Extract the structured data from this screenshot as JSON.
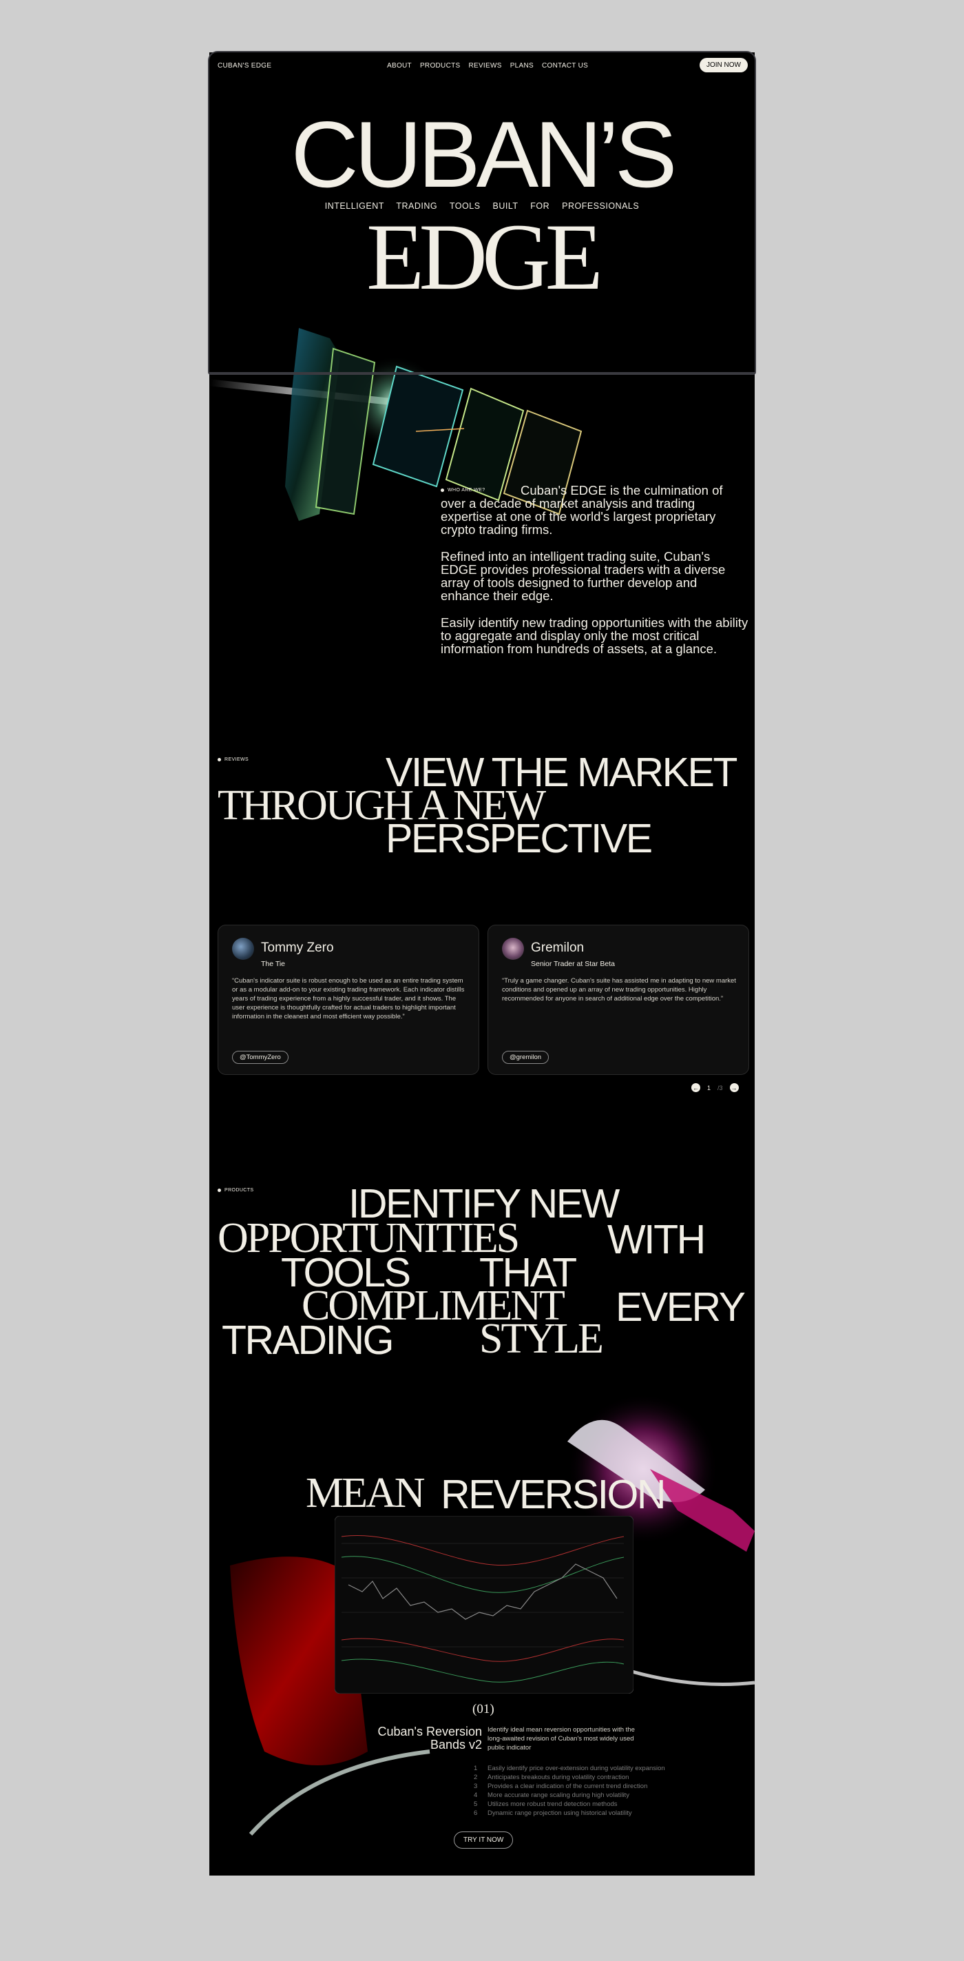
{
  "nav": {
    "brand": "CUBAN'S EDGE",
    "links": [
      "ABOUT",
      "PRODUCTS",
      "REVIEWS",
      "PLANS",
      "CONTACT US"
    ],
    "cta": "JOIN NOW"
  },
  "hero": {
    "title_top": "CUBAN’S",
    "tagline": "INTELLIGENT TRADING TOOLS BUILT FOR PROFESSIONALS",
    "title_bottom": "EDGE"
  },
  "about": {
    "label": "WHO ARE WE?",
    "paragraphs": [
      "Cuban's EDGE is the culmination of over a decade of market analysis and trading expertise at one of the world's largest proprietary crypto trading firms.",
      "Refined into an intelligent trading suite, Cuban's EDGE provides professional traders with a diverse array of tools designed to further develop and enhance their edge.",
      "Easily identify new trading opportunities with the ability to aggregate and display only the most critical information from hundreds of assets, at a glance."
    ]
  },
  "reviews": {
    "label": "REVIEWS",
    "heading": [
      "VIEW THE MARKET",
      "THROUGH A NEW",
      "PERSPECTIVE"
    ],
    "cards": [
      {
        "name": "Tommy Zero",
        "role": "The Tie",
        "quote": "“Cuban's indicator suite is robust enough to be used as an entire trading system or as a modular add-on to your existing trading framework. Each indicator distills years of trading experience from a highly successful trader, and it shows. The user experience is thoughtfully crafted for actual traders to highlight important information in the cleanest and most efficient way possible.”",
        "handle": "@TommyZero"
      },
      {
        "name": "Gremilon",
        "role": "Senior Trader at Star Beta",
        "quote": "“Truly a game changer. Cuban's suite has assisted me in adapting to new market conditions and opened up an array of new trading opportunities. Highly recommended for anyone in search of additional edge over the competition.”",
        "handle": "@gremilon"
      }
    ],
    "pager": {
      "current": "1",
      "total": "/3"
    }
  },
  "products": {
    "label": "PRODUCTS",
    "heading": {
      "l1": "IDENTIFY NEW",
      "l2a": "OPPORTUNITIES",
      "l2b": "WITH",
      "l3a": "TOOLS",
      "l3b": "THAT",
      "l4a": "COMPLIMENT",
      "l4b": "EVERY",
      "l5a": "TRADING",
      "l5b": "STYLE"
    },
    "product_title_serif": "MEAN",
    "product_title_sans": "REVERSION",
    "index": "(01)",
    "product_name": "Cuban's Reversion Bands v2",
    "description": "Identify ideal mean reversion opportunities with the long-awaited revision of Cuban's most widely used public indicator",
    "features": [
      "Easily identify price over-extension during volatility expansion",
      "Anticipates breakouts during volatility contraction",
      "Provides a clear indication of the current trend direction",
      "More accurate range scaling during high volatility",
      "Utilizes more robust trend detection methods",
      "Dynamic range projection using historical volatility"
    ],
    "cta": "TRY IT NOW"
  },
  "colors": {
    "page_bg": "#cfcfcf",
    "site_bg": "#000000",
    "text": "#f2efe6",
    "accent_red": "#a00000"
  }
}
